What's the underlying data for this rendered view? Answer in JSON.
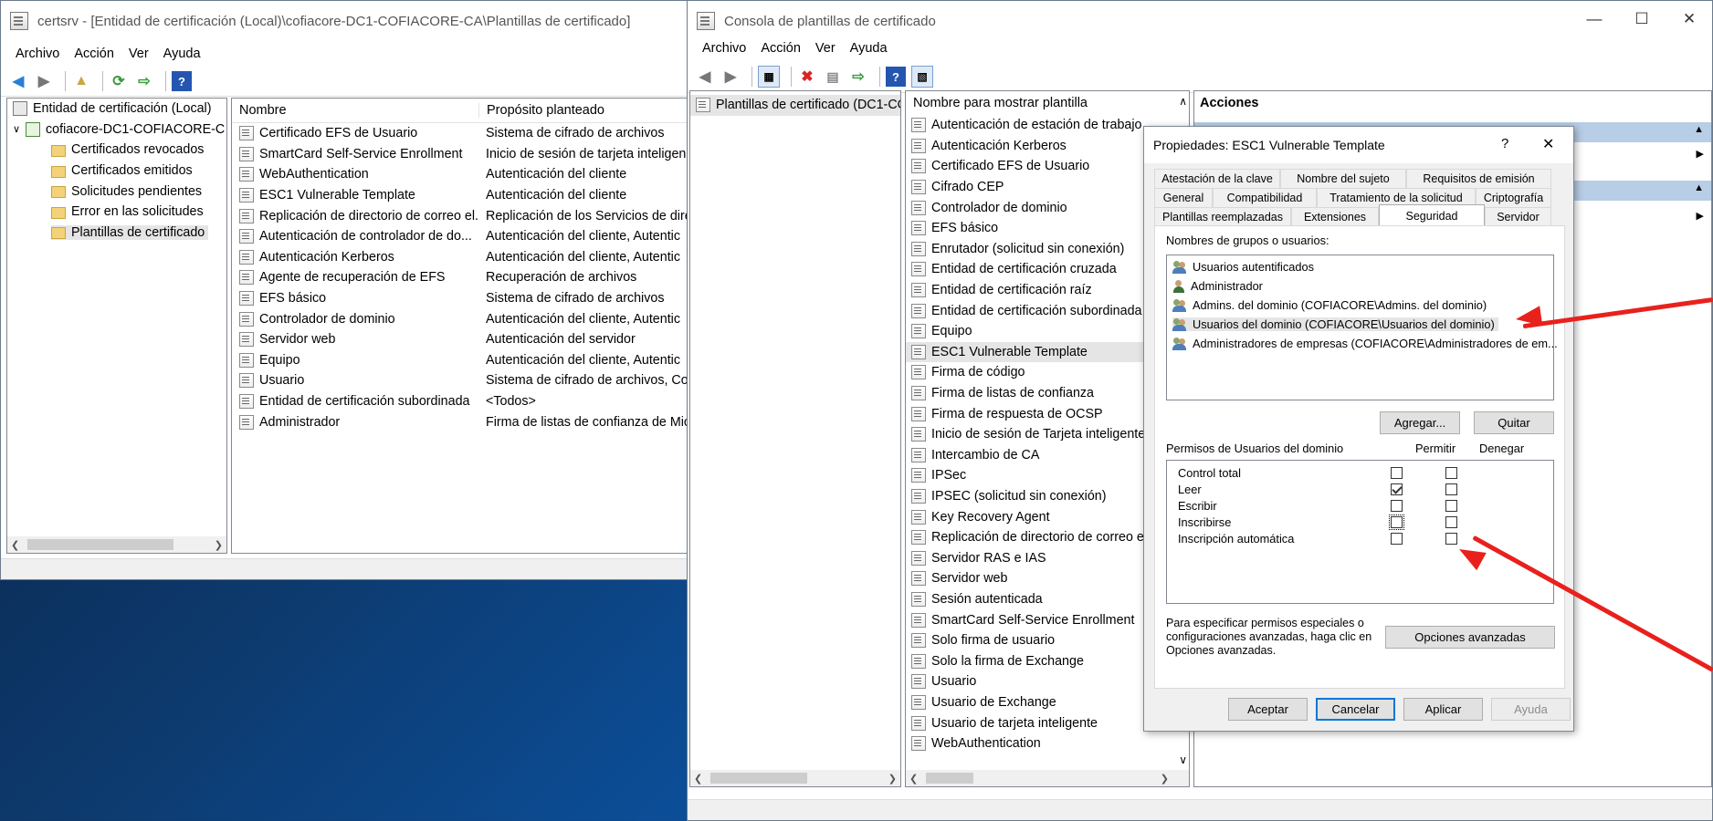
{
  "win1": {
    "title": "certsrv - [Entidad de certificación (Local)\\cofiacore-DC1-COFIACORE-CA\\Plantillas de certificado]",
    "menu": [
      "Archivo",
      "Acción",
      "Ver",
      "Ayuda"
    ],
    "tree": {
      "root": "Entidad de certificación (Local)",
      "ca": "cofiacore-DC1-COFIACORE-C",
      "folders": [
        "Certificados revocados",
        "Certificados emitidos",
        "Solicitudes pendientes",
        "Error en las solicitudes",
        "Plantillas de certificado"
      ]
    },
    "list": {
      "col_name": "Nombre",
      "col_purpose": "Propósito planteado",
      "rows": [
        {
          "name": "Certificado EFS de Usuario",
          "purpose": "Sistema de cifrado de archivos"
        },
        {
          "name": "SmartCard Self-Service Enrollment",
          "purpose": "Inicio de sesión de tarjeta inteligen"
        },
        {
          "name": "WebAuthentication",
          "purpose": "Autenticación del cliente"
        },
        {
          "name": "ESC1 Vulnerable Template",
          "purpose": "Autenticación del cliente"
        },
        {
          "name": "Replicación de directorio de correo el...",
          "purpose": "Replicación de los Servicios de dire"
        },
        {
          "name": "Autenticación de controlador de do...",
          "purpose": "Autenticación del cliente, Autentic"
        },
        {
          "name": "Autenticación Kerberos",
          "purpose": "Autenticación del cliente, Autentic"
        },
        {
          "name": "Agente de recuperación de EFS",
          "purpose": "Recuperación de archivos"
        },
        {
          "name": "EFS básico",
          "purpose": "Sistema de cifrado de archivos"
        },
        {
          "name": "Controlador de dominio",
          "purpose": "Autenticación del cliente, Autentic"
        },
        {
          "name": "Servidor web",
          "purpose": "Autenticación del servidor"
        },
        {
          "name": "Equipo",
          "purpose": "Autenticación del cliente, Autentic"
        },
        {
          "name": "Usuario",
          "purpose": "Sistema de cifrado de archivos, Co"
        },
        {
          "name": "Entidad de certificación subordinada",
          "purpose": "<Todos>"
        },
        {
          "name": "Administrador",
          "purpose": "Firma de listas de confianza de Mic"
        }
      ]
    }
  },
  "win2": {
    "title": "Consola de plantillas de certificado",
    "menu": [
      "Archivo",
      "Acción",
      "Ver",
      "Ayuda"
    ],
    "tree_item": "Plantillas de certificado (DC1-CO",
    "list_header": "Nombre para mostrar plantilla",
    "templates": [
      "Autenticación de estación de trabajo",
      "Autenticación Kerberos",
      "Certificado EFS de Usuario",
      "Cifrado CEP",
      "Controlador de dominio",
      "EFS básico",
      "Enrutador (solicitud sin conexión)",
      "Entidad de certificación cruzada",
      "Entidad de certificación raíz",
      "Entidad de certificación subordinada",
      "Equipo",
      "ESC1 Vulnerable Template",
      "Firma de código",
      "Firma de listas de confianza",
      "Firma de respuesta de OCSP",
      "Inicio de sesión de Tarjeta inteligente",
      "Intercambio de CA",
      "IPSec",
      "IPSEC (solicitud sin conexión)",
      "Key Recovery Agent",
      "Replicación de directorio de correo ele",
      "Servidor RAS e IAS",
      "Servidor web",
      "Sesión autenticada",
      "SmartCard Self-Service Enrollment",
      "Solo firma de usuario",
      "Solo la firma de Exchange",
      "Usuario",
      "Usuario de Exchange",
      "Usuario de tarjeta inteligente",
      "WebAuthentication"
    ],
    "selected_template": "ESC1 Vulnerable Template",
    "actions_header": "Acciones"
  },
  "dialog": {
    "title": "Propiedades: ESC1 Vulnerable Template",
    "help": "?",
    "close": "✕",
    "tabs_row1": [
      "Atestación de la clave",
      "Nombre del sujeto",
      "Requisitos de emisión"
    ],
    "tabs_row2": [
      "General",
      "Compatibilidad",
      "Tratamiento de la solicitud",
      "Criptografía"
    ],
    "tabs_row3": [
      "Plantillas reemplazadas",
      "Extensiones",
      "Seguridad",
      "Servidor"
    ],
    "groups_label": "Nombres de grupos o usuarios:",
    "groups": [
      {
        "name": "Usuarios autentificados",
        "icon": "users"
      },
      {
        "name": "Administrador",
        "icon": "user"
      },
      {
        "name": "Admins. del dominio (COFIACORE\\Admins. del dominio)",
        "icon": "users"
      },
      {
        "name": "Usuarios del dominio (COFIACORE\\Usuarios del dominio)",
        "icon": "users"
      },
      {
        "name": "Administradores de empresas (COFIACORE\\Administradores de em...",
        "icon": "users"
      }
    ],
    "selected_group": "Usuarios del dominio (COFIACORE\\Usuarios del dominio)",
    "add_btn": "Agregar...",
    "remove_btn": "Quitar",
    "perm_label": "Permisos de Usuarios del dominio",
    "allow_label": "Permitir",
    "deny_label": "Denegar",
    "permissions": [
      {
        "name": "Control total",
        "allow": false,
        "deny": false
      },
      {
        "name": "Leer",
        "allow": true,
        "deny": false
      },
      {
        "name": "Escribir",
        "allow": false,
        "deny": false
      },
      {
        "name": "Inscribirse",
        "allow": false,
        "deny": false
      },
      {
        "name": "Inscripción automática",
        "allow": false,
        "deny": false
      }
    ],
    "advanced_text": "Para especificar permisos especiales o configuraciones avanzadas, haga clic en Opciones avanzadas.",
    "advanced_btn": "Opciones avanzadas",
    "ok_btn": "Aceptar",
    "cancel_btn": "Cancelar",
    "apply_btn": "Aplicar",
    "help_btn": "Ayuda"
  },
  "colors": {
    "annotation_arrow": "#e8211d",
    "selection": "#e5e5e5",
    "actions_bar": "#b8cde6"
  }
}
